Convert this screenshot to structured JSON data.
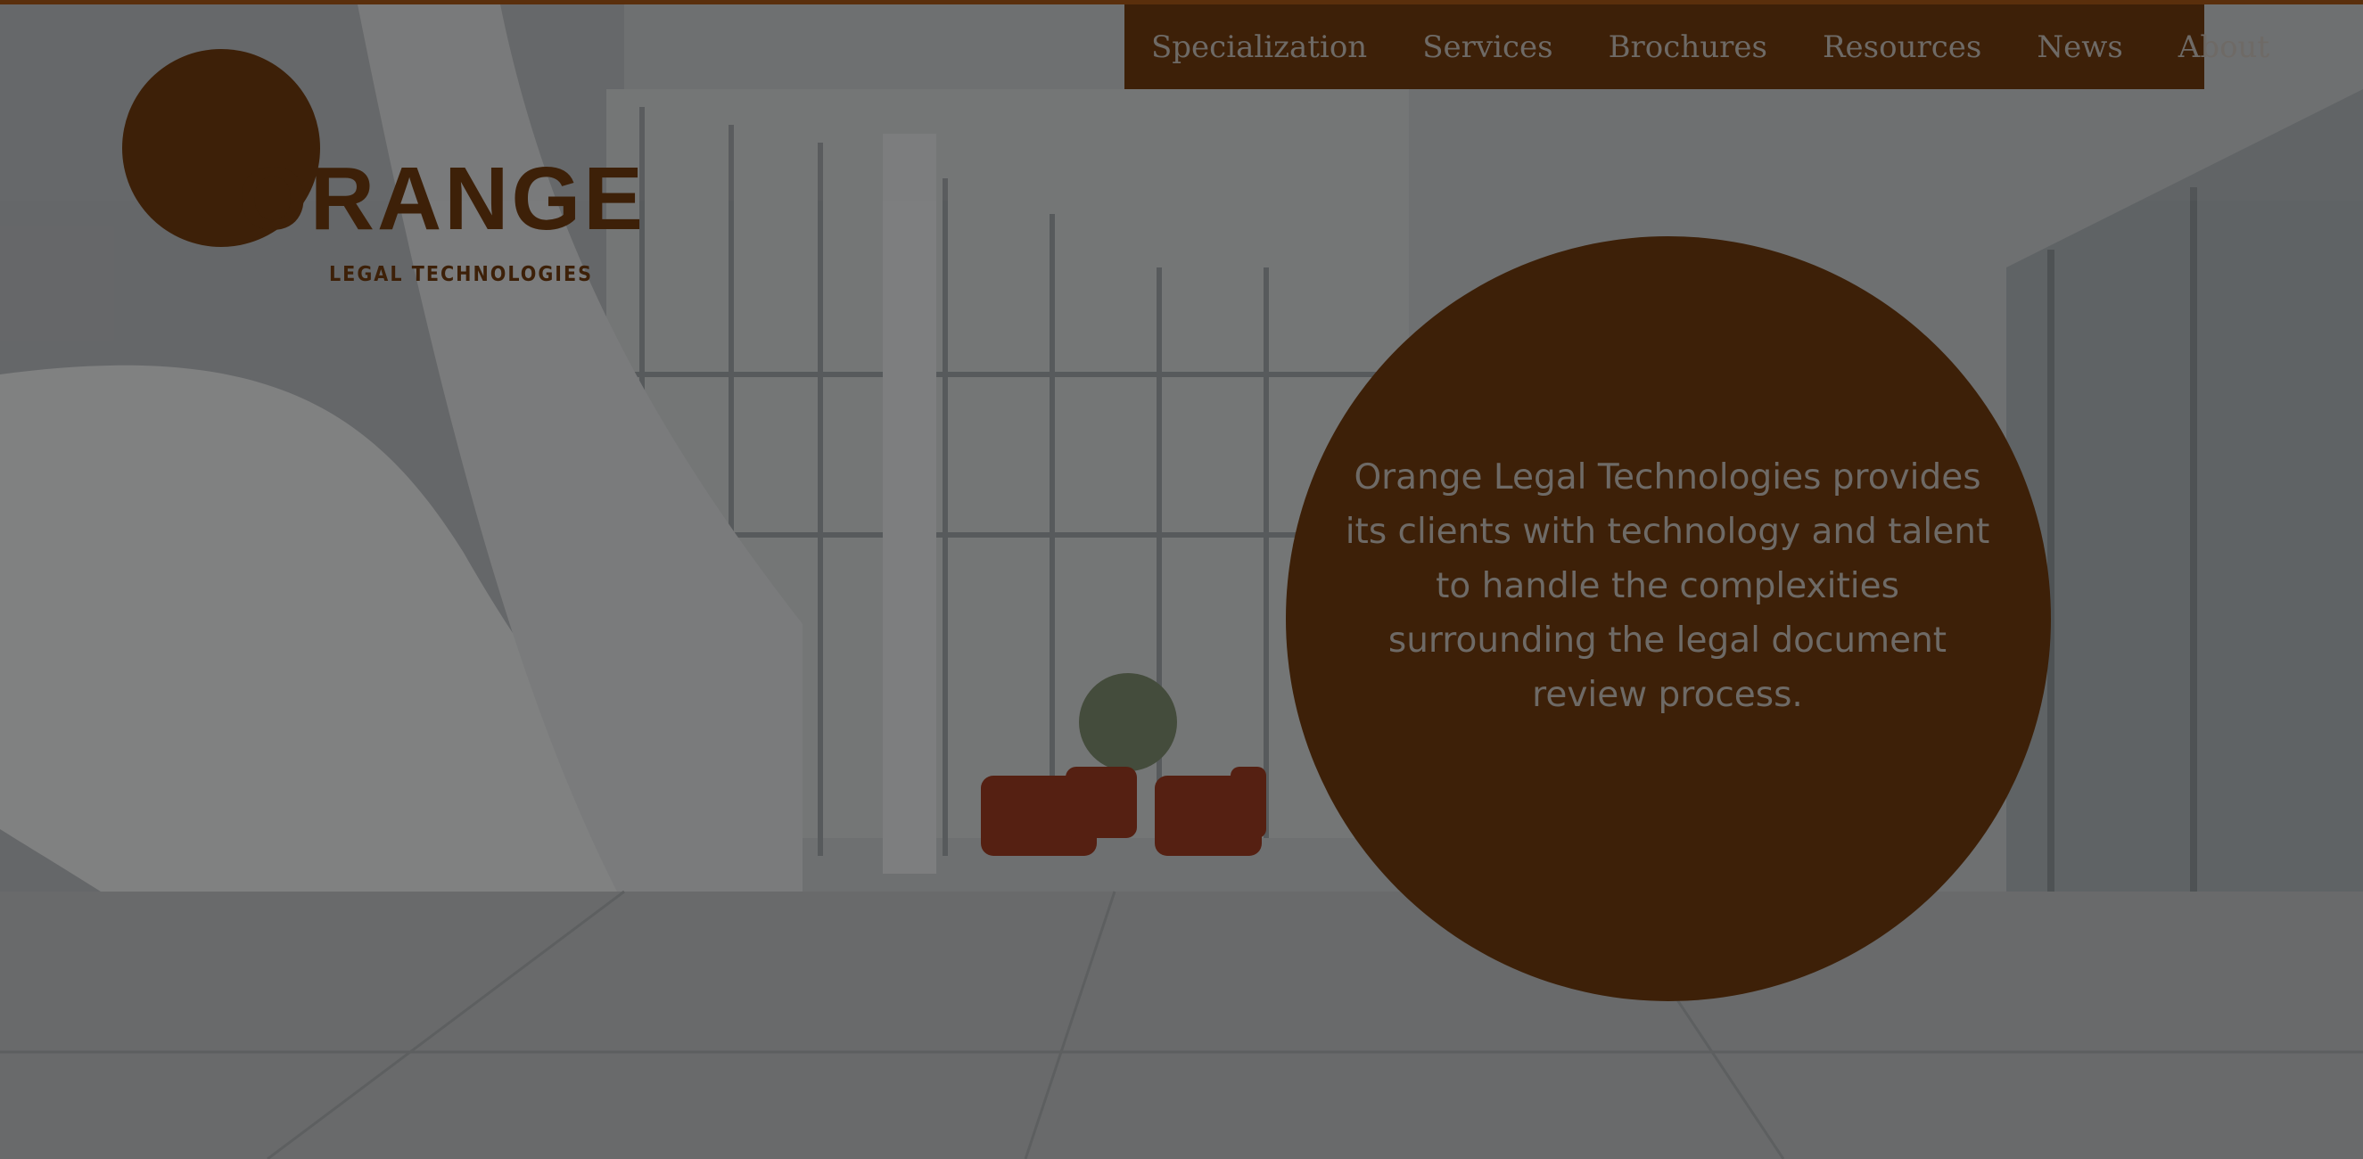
{
  "brand": {
    "logo_word": "ORANGE",
    "logo_sub": "LEGAL TECHNOLOGIES",
    "colors": {
      "brand_dark": "#3d2008",
      "accent_line": "#5a2f0c",
      "muted_text": "#6e6a66"
    }
  },
  "nav": {
    "items": [
      {
        "label": "Specialization"
      },
      {
        "label": "Services"
      },
      {
        "label": "Brochures"
      },
      {
        "label": "Resources"
      },
      {
        "label": "News"
      },
      {
        "label": "About"
      }
    ]
  },
  "hero": {
    "text": "Orange Legal Technologies provides its clients with technology and talent to handle the complexities surrounding the legal document review process."
  },
  "background": {
    "description_icon": "office-lobby-photo"
  }
}
